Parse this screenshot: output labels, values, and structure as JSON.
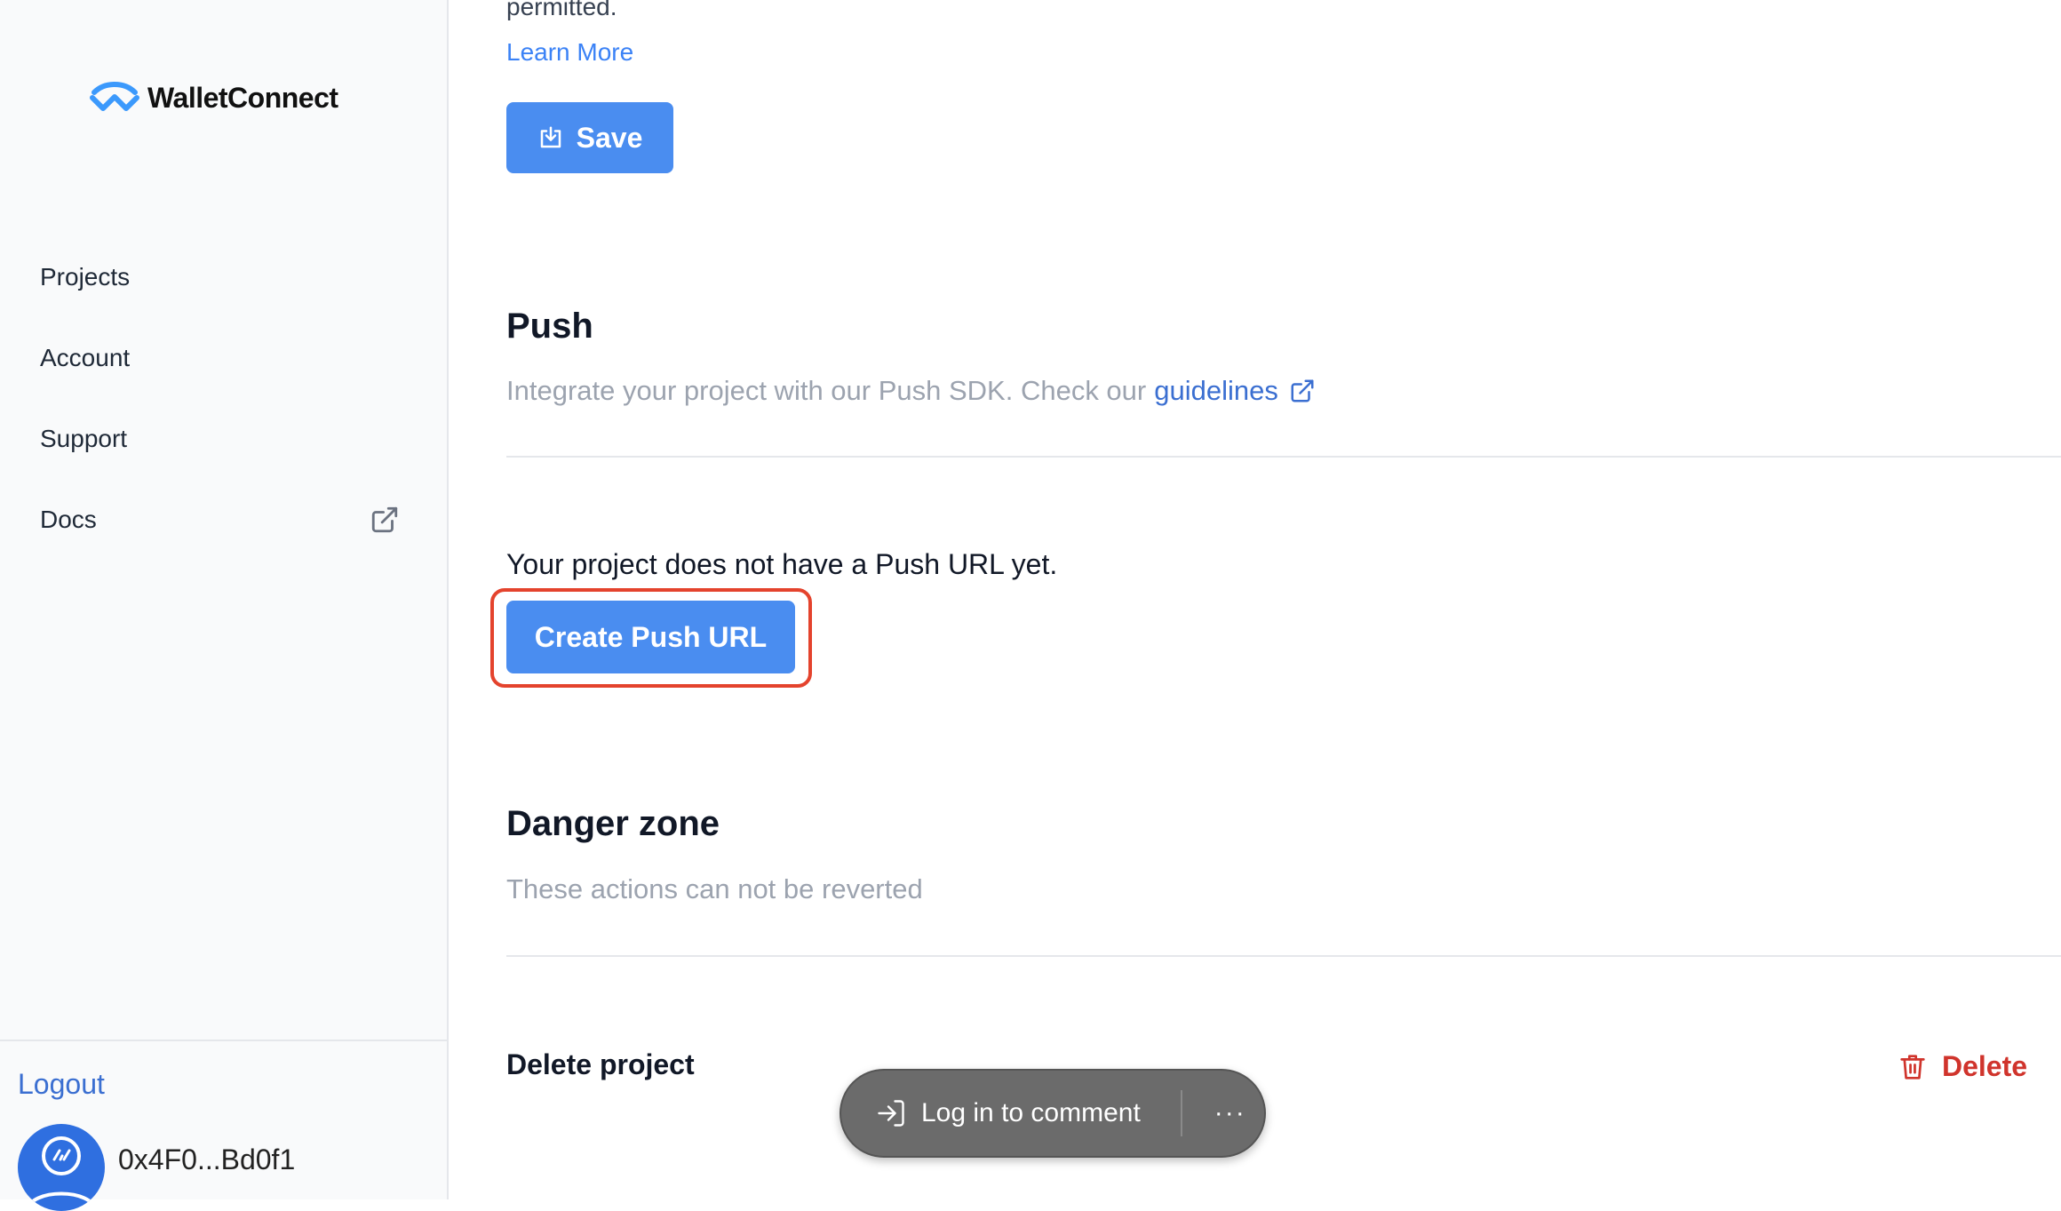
{
  "sidebar": {
    "logo_text": "WalletConnect",
    "items": [
      {
        "label": "Projects"
      },
      {
        "label": "Account"
      },
      {
        "label": "Support"
      },
      {
        "label": "Docs"
      }
    ],
    "logout_label": "Logout",
    "address": "0x4F0...Bd0f1"
  },
  "main": {
    "permitted_text": "permitted.",
    "learn_more": "Learn More",
    "save_label": "Save",
    "push": {
      "title": "Push",
      "description": "Integrate your project with our Push SDK. Check our",
      "guidelines_link": "guidelines",
      "no_url_text": "Your project does not have a Push URL yet.",
      "create_button": "Create Push URL"
    },
    "danger": {
      "title": "Danger zone",
      "description": "These actions can not be reverted",
      "delete_project_label": "Delete project",
      "delete_button": "Delete"
    }
  },
  "comment_bar": {
    "login_label": "Log in to comment",
    "more_label": "···"
  },
  "colors": {
    "accent": "#4a8df0",
    "link": "#3b6fd1",
    "danger": "#d0342c",
    "highlight": "#e4432d"
  }
}
